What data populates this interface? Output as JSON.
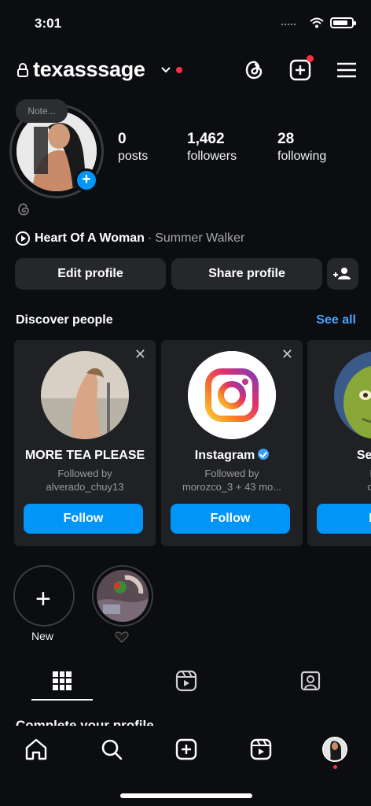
{
  "status": {
    "time": "3:01"
  },
  "header": {
    "username": "texasssage",
    "icons": [
      "lock-icon",
      "chevron-down-icon",
      "threads-icon",
      "create-icon",
      "menu-icon"
    ]
  },
  "profile": {
    "note": "Note...",
    "stats": [
      {
        "num": "0",
        "label": "posts"
      },
      {
        "num": "1,462",
        "label": "followers"
      },
      {
        "num": "28",
        "label": "following"
      }
    ],
    "music": {
      "song": "Heart Of A Woman",
      "sep": "·",
      "artist": "Summer Walker"
    },
    "buttons": {
      "edit": "Edit profile",
      "share": "Share profile"
    }
  },
  "discover": {
    "title": "Discover people",
    "see_all": "See all",
    "cards": [
      {
        "name": "MORE TEA PLEASE",
        "sub1": "Followed by",
        "sub2": "alverado_chuy13",
        "follow": "Follow"
      },
      {
        "name": "Instagram",
        "verified": true,
        "sub1": "Followed by",
        "sub2": "morozco_3 + 43 mo...",
        "follow": "Follow"
      },
      {
        "name": "Senora",
        "sub1": "Foll",
        "sub2": "chus",
        "follow": "Fo"
      }
    ]
  },
  "highlights": {
    "new_label": "New"
  },
  "tabs": [
    "grid-icon",
    "reels-icon",
    "tagged-icon"
  ],
  "complete_profile": "Complete your profile",
  "colors": {
    "accent": "#0095f6",
    "link": "#4aa3ff",
    "notify": "#ff3040",
    "bg": "#0b0d10",
    "card": "#1f2125"
  }
}
